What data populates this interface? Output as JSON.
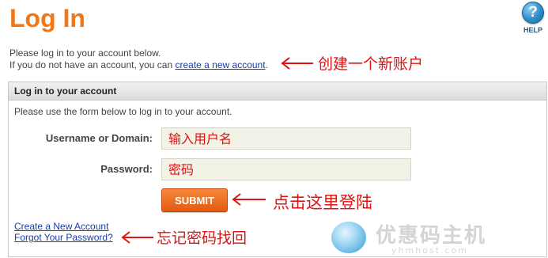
{
  "page": {
    "title": "Log In",
    "help_label": "HELP",
    "help_glyph": "?",
    "intro_line1": "Please log in to your account below.",
    "intro_line2_prefix": "If you do not have an account, you can ",
    "intro_link": "create a new account",
    "intro_line2_suffix": "."
  },
  "panel": {
    "header": "Log in to your account",
    "description": "Please use the form below to log in to your account.",
    "username_label": "Username or Domain:",
    "username_placeholder": "输入用户名",
    "password_label": "Password:",
    "password_placeholder": "密码",
    "submit_label": "SUBMIT",
    "create_link": "Create a New Account",
    "forgot_link": "Forgot Your Password?"
  },
  "annotations": {
    "create_account": "创建一个新账户",
    "click_login": "点击这里登陆",
    "forgot_password": "忘记密码找回"
  },
  "watermark": {
    "text": "优惠码主机",
    "url": "yhmhost.com"
  },
  "colors": {
    "title": "#f07818",
    "annotation": "#e01212",
    "link": "#1a3da0",
    "submit": "#e8661c"
  }
}
